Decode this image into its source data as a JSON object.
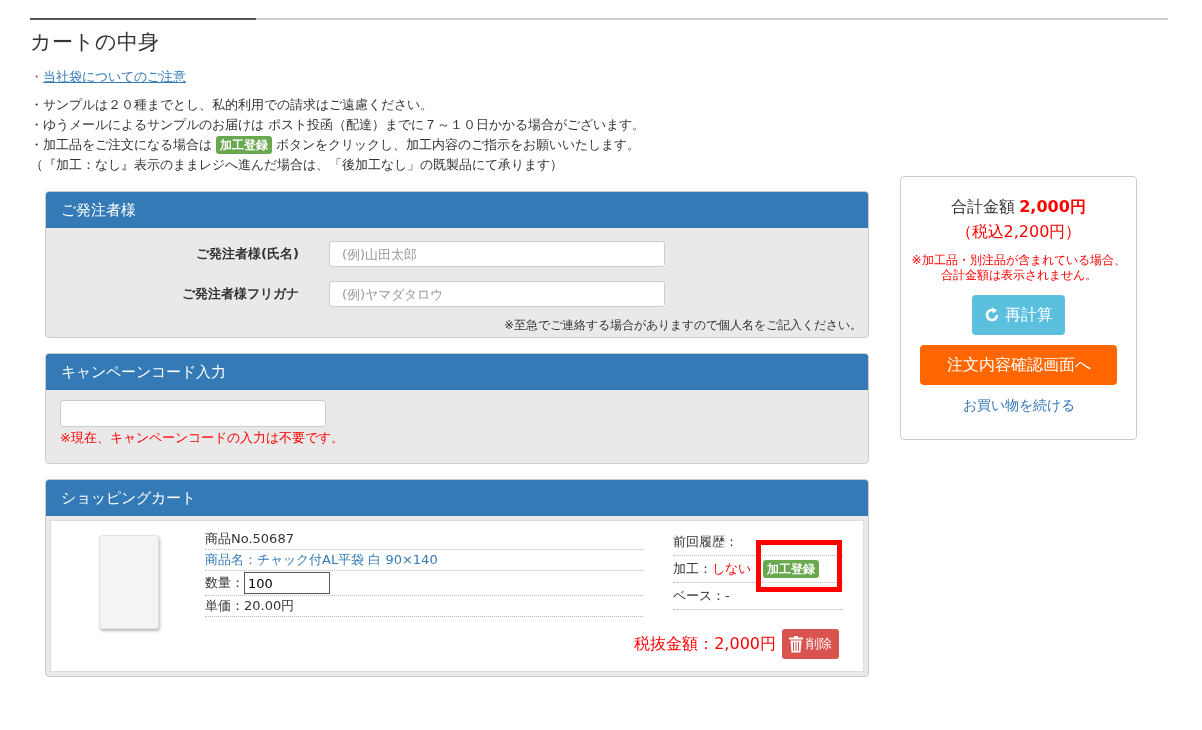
{
  "page_title": "カートの中身",
  "notice_link": {
    "bullet": "・",
    "label": "当社袋についてのご注意"
  },
  "notes": [
    {
      "kind": "text",
      "text": "・サンプルは２０種までとし、私的利用での請求はご遠慮ください。"
    },
    {
      "kind": "text",
      "text": "・ゆうメールによるサンプルのお届けは ポスト投函（配達）までに７～１０日かかる場合がございます。"
    },
    {
      "kind": "badge",
      "before": "・加工品をご注文になる場合は",
      "badge": "加工登録",
      "after": "ボタンをクリックし、加工内容のご指示をお願いいたします。"
    },
    {
      "kind": "text",
      "text": "（『加工：なし』表示のままレジへ進んだ場合は、「後加工なし」の既製品にて承ります）"
    }
  ],
  "orderer": {
    "title": "ご発注者様",
    "fields": [
      {
        "label": "ご発注者様(氏名)",
        "placeholder": "(例)山田太郎"
      },
      {
        "label": "ご発注者様フリガナ",
        "placeholder": "(例)ヤマダタロウ"
      }
    ],
    "note": "※至急でご連絡する場合がありますので個人名をご記入ください。"
  },
  "campaign": {
    "title": "キャンペーンコード入力",
    "note": "※現在、キャンペーンコードの入力は不要です。"
  },
  "cart": {
    "title": "ショッピングカート",
    "items": [
      {
        "product_no": "商品No.50687",
        "name": "商品名：チャック付AL平袋 白 90×140",
        "qty_label": "数量：",
        "qty": "100",
        "price": "単価：20.00円",
        "history_label": "前回履歴：",
        "processing_label": "加工：",
        "processing_value": "しない",
        "processing_button": "加工登録",
        "highlighted": true,
        "base": "ベース：-",
        "subtotal": "税抜金額：2,000円",
        "delete": "削除"
      }
    ]
  },
  "summary": {
    "total_label": "合計金額",
    "total": "2,000円",
    "tax_included": "（税込2,200円）",
    "note": "※加工品・別注品が含まれている場合、合計金額は表示されません。",
    "recalc": "再計算",
    "confirm": "注文内容確認画面へ",
    "continue": "お買い物を続ける"
  }
}
